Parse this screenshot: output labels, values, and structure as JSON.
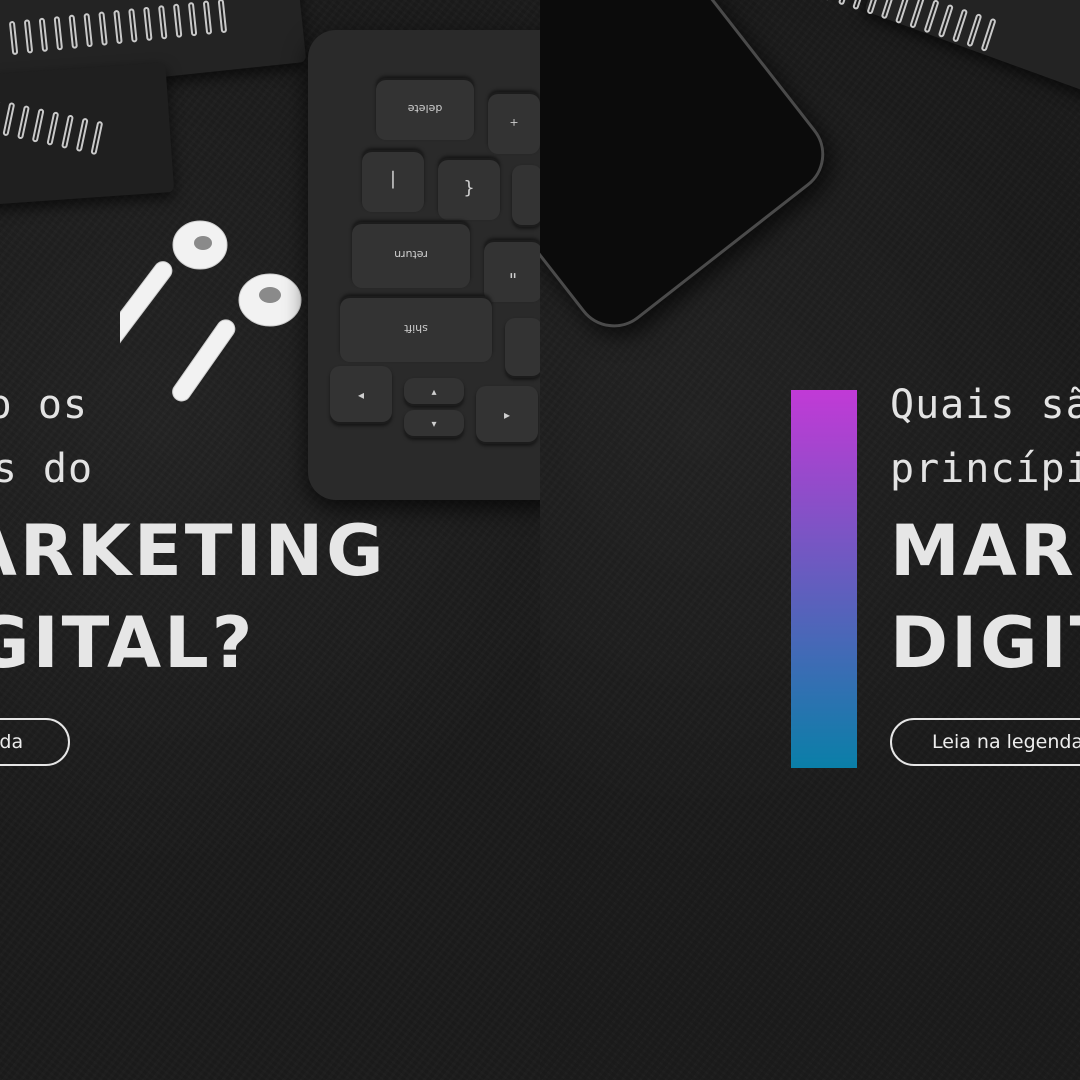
{
  "slides": [
    {
      "line1": "Quais são os",
      "line2": "princípios do",
      "line3": "MARKETING",
      "line4": "DIGITAL?",
      "cta": "Leia na legenda"
    },
    {
      "line1": "Quais são os",
      "line2": "princípios do",
      "line3": "MARKETING",
      "line4": "DIGITAL?",
      "cta": "Leia na legenda"
    }
  ],
  "keyboard_keys": {
    "delete": "delete",
    "return": "return",
    "shift": "shift",
    "plus": "+",
    "equals": "=",
    "pipe": "|",
    "slash": "/",
    "brace": "{",
    "bracket": "[",
    "quote": "\"",
    "apostrophe": "'"
  },
  "colors": {
    "background": "#1a1a1a",
    "text": "#e6e6e6",
    "accent_top": "#c13ad6",
    "accent_bottom": "#0a7fa8"
  }
}
